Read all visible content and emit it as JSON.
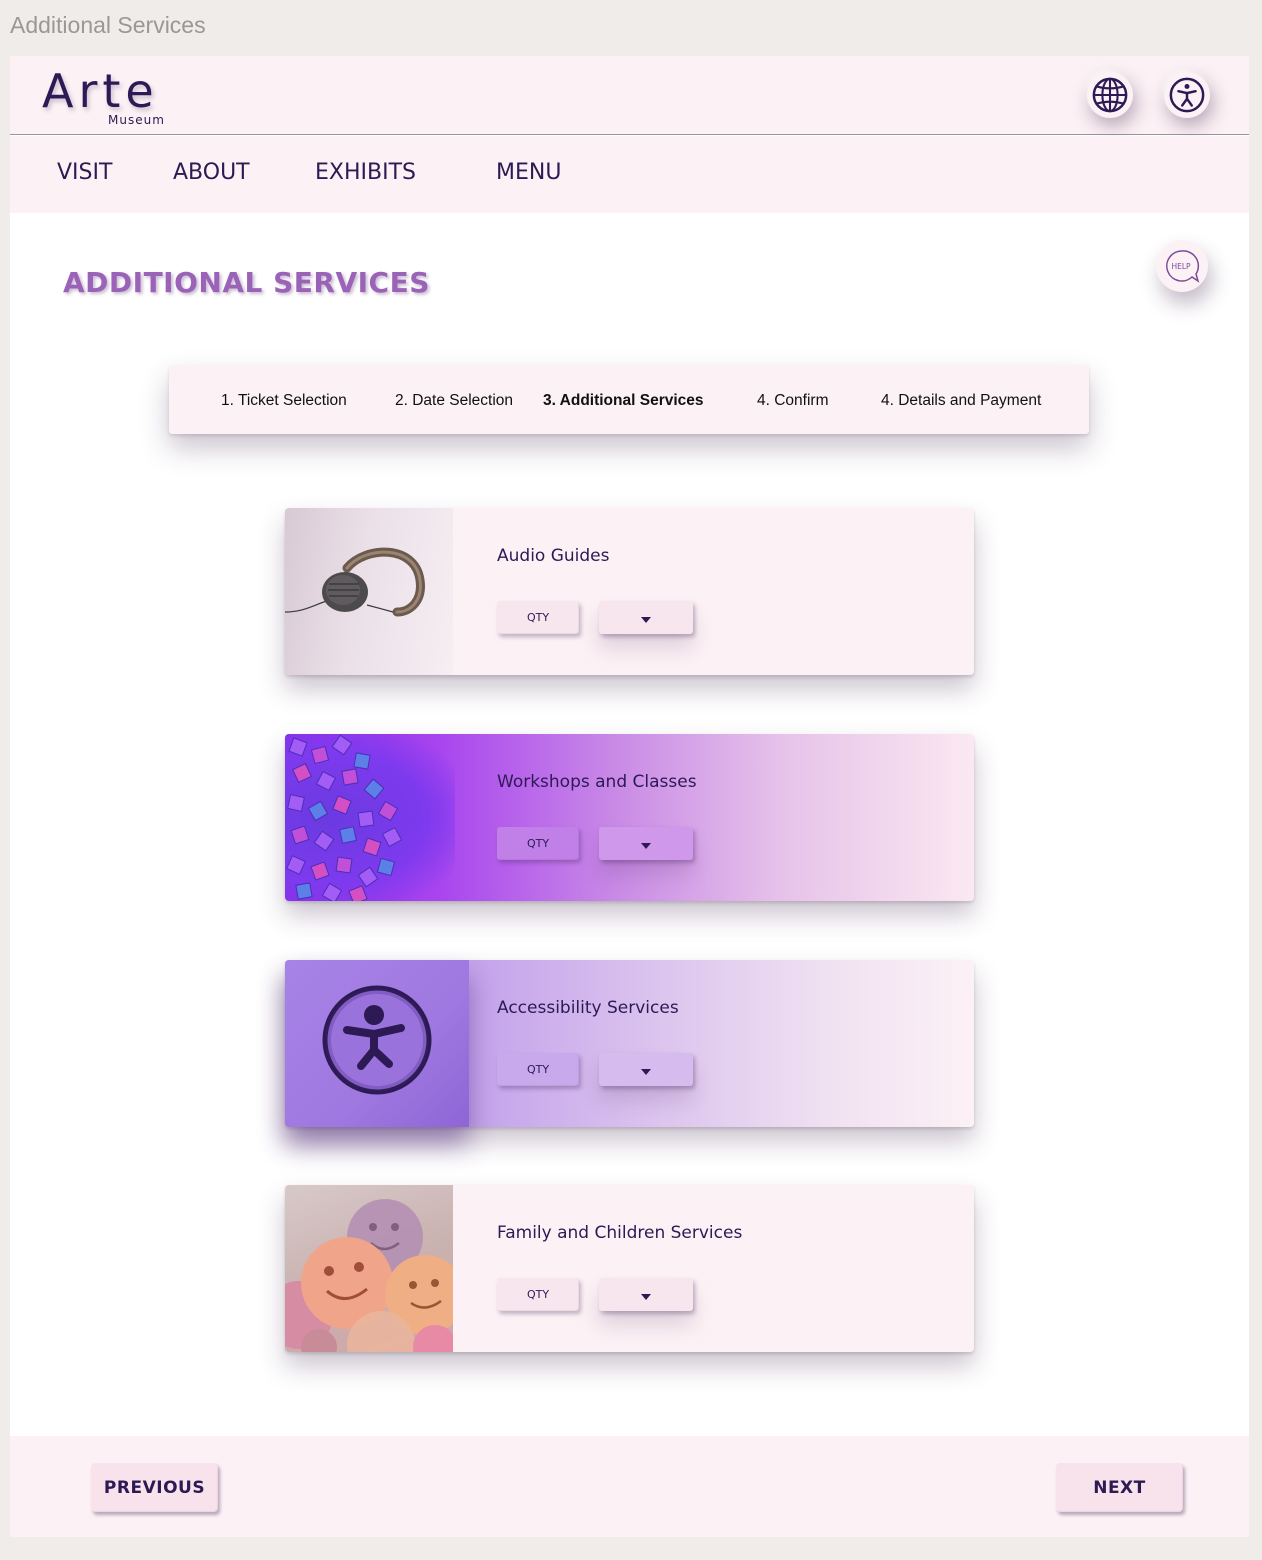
{
  "window": {
    "title": "Additional Services"
  },
  "header": {
    "logo": {
      "name": "Arte",
      "sub": "Museum"
    },
    "buttons": [
      {
        "icon": "globe-icon",
        "label": "Language"
      },
      {
        "icon": "accessibility-icon",
        "label": "Accessibility"
      }
    ]
  },
  "nav": {
    "items": [
      "VISIT",
      "ABOUT",
      "EXHIBITS",
      "MENU"
    ]
  },
  "main": {
    "title": "ADDITIONAL SERVICES",
    "help_label": "HELP",
    "steps": [
      {
        "label": "1. Ticket Selection",
        "active": false
      },
      {
        "label": "2. Date Selection",
        "active": false
      },
      {
        "label": "3. Additional Services",
        "active": true
      },
      {
        "label": "4. Confirm",
        "active": false
      },
      {
        "label": "4. Details and Payment",
        "active": false
      }
    ],
    "services": [
      {
        "title": "Audio Guides",
        "qty_label": "QTY",
        "image": "headphones"
      },
      {
        "title": "Workshops and Classes",
        "qty_label": "QTY",
        "image": "purple-cubes"
      },
      {
        "title": "Accessibility Services",
        "qty_label": "QTY",
        "image": "accessibility-icon"
      },
      {
        "title": "Family and Children Services",
        "qty_label": "QTY",
        "image": "smiley-balloons"
      }
    ]
  },
  "footer": {
    "previous_label": "PREVIOUS",
    "next_label": "NEXT"
  },
  "colors": {
    "accent": "#9b63b8",
    "text": "#2d1a55",
    "surface": "#fcf1f5",
    "background": "#efecea"
  }
}
